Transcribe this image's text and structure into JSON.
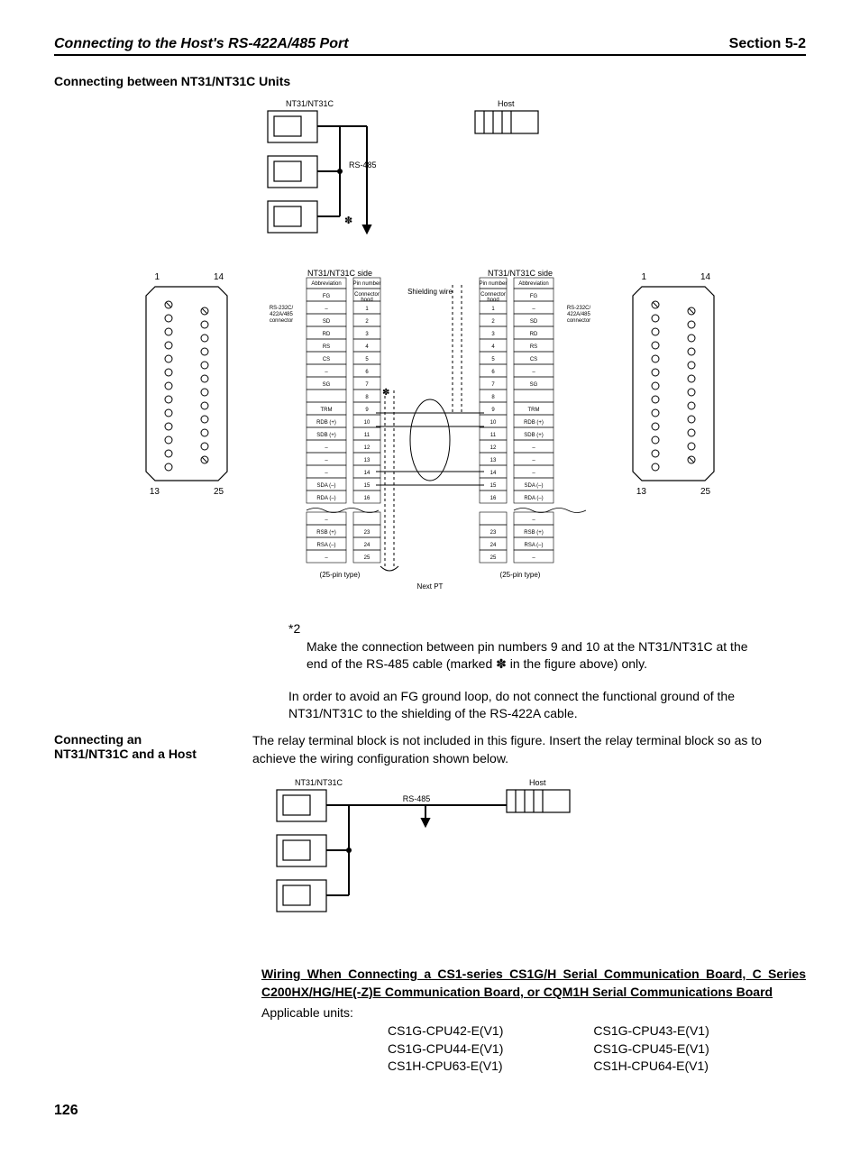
{
  "header": {
    "left": "Connecting to the Host's RS-422A/485 Port",
    "right": "Section   5-2"
  },
  "section1_title": "Connecting between NT31/NT31C Units",
  "diag1": {
    "nt_label": "NT31/NT31C",
    "host_label": "Host",
    "rs485": "RS-485",
    "star": "✽"
  },
  "pinout": {
    "left_side": "NT31/NT31C side",
    "right_side": "NT31/NT31C side",
    "shielding": "Shielding wire",
    "conn_label": "RS-232C/\n422A/485\nconnector",
    "type": "(25-pin type)",
    "next_pt": "Next PT",
    "col_abbr": "Abbreviation",
    "col_pin": "Pin number",
    "col_conn": "Connector\nhood",
    "pins_left": [
      {
        "a": "FG",
        "p": "Connector\nhood"
      },
      {
        "a": "–",
        "p": "1"
      },
      {
        "a": "SD",
        "p": "2"
      },
      {
        "a": "RD",
        "p": "3"
      },
      {
        "a": "RS",
        "p": "4"
      },
      {
        "a": "CS",
        "p": "5"
      },
      {
        "a": "–",
        "p": "6"
      },
      {
        "a": "SG",
        "p": "7"
      },
      {
        "a": "",
        "p": "8"
      },
      {
        "a": "TRM",
        "p": "9"
      },
      {
        "a": "RDB (+)",
        "p": "10"
      },
      {
        "a": "SDB (+)",
        "p": "11"
      },
      {
        "a": "–",
        "p": "12"
      },
      {
        "a": "–",
        "p": "13"
      },
      {
        "a": "–",
        "p": "14"
      },
      {
        "a": "SDA (–)",
        "p": "15"
      },
      {
        "a": "RDA (–)",
        "p": "16"
      },
      {
        "a": "–",
        "p": ""
      },
      {
        "a": "RSB (+)",
        "p": "23"
      },
      {
        "a": "RSA (–)",
        "p": "24"
      },
      {
        "a": "–",
        "p": "25"
      }
    ],
    "corner": {
      "tl": "1",
      "tr": "14",
      "bl": "13",
      "br": "25"
    }
  },
  "note2": {
    "marker": "*2",
    "text": "Make the connection between pin numbers 9 and 10 at the NT31/NT31C at the end of the RS-485 cable (marked ✽ in the figure above) only."
  },
  "fg_loop": "In order to avoid an FG ground loop, do not connect the functional ground of the NT31/NT31C to the shielding of the RS-422A cable.",
  "section2": {
    "title": "Connecting an NT31/NT31C and a Host",
    "text": "The relay terminal block is not included in this figure. Insert the relay terminal block so as to achieve the wiring configuration shown below."
  },
  "diag2": {
    "nt_label": "NT31/NT31C",
    "host_label": "Host",
    "rs485": "RS-485"
  },
  "wiring_heading": "Wiring When Connecting a CS1-series CS1G/H Serial Communication Board, C Series C200HX/HG/HE(-Z)E Communication Board, or CQM1H Serial Communications Board",
  "applicable": "Applicable units:",
  "units": {
    "col1": [
      "CS1G-CPU42-E(V1)",
      "CS1G-CPU44-E(V1)",
      "CS1H-CPU63-E(V1)"
    ],
    "col2": [
      "CS1G-CPU43-E(V1)",
      "CS1G-CPU45-E(V1)",
      "CS1H-CPU64-E(V1)"
    ]
  },
  "page": "126"
}
